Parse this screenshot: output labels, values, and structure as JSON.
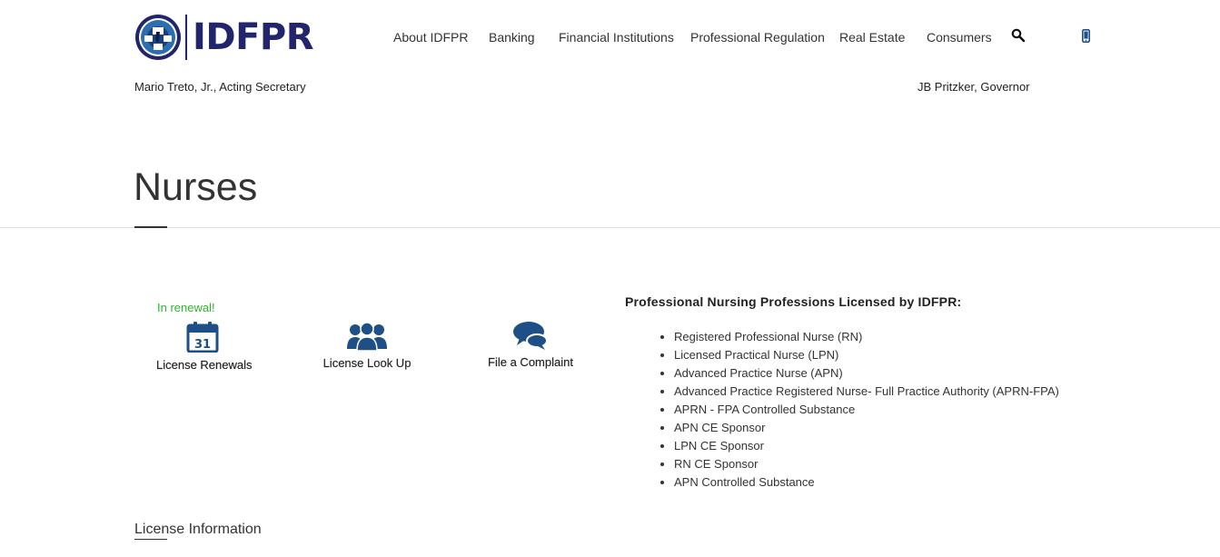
{
  "header": {
    "logo_text": "IDFPR",
    "secretary": "Mario Treto, Jr., Acting Secretary",
    "governor": "JB Pritzker, Governor",
    "nav": [
      {
        "label": "About IDFPR"
      },
      {
        "label": "Banking"
      },
      {
        "label": "Financial Institutions"
      },
      {
        "label": "Professional Regulation"
      },
      {
        "label": "Real Estate"
      },
      {
        "label": "Consumers"
      }
    ],
    "icons": {
      "search": "search-icon",
      "mobile": "mobile-phone-icon"
    }
  },
  "page": {
    "title": "Nurses"
  },
  "quick_links": {
    "renewal_note": "In renewal!",
    "calendar_day": "31",
    "items": [
      {
        "label": "License Renewals",
        "icon": "calendar-icon"
      },
      {
        "label": "License Look Up",
        "icon": "people-icon"
      },
      {
        "label": "File a Complaint",
        "icon": "speech-bubbles-icon"
      }
    ]
  },
  "professions": {
    "heading": "Professional Nursing Professions Licensed by IDFPR:",
    "items": [
      "Registered Professional Nurse (RN)",
      "Licensed Practical Nurse (LPN)",
      "Advanced Practice Nurse (APN)",
      "Advanced Practice Registered Nurse- Full Practice Authority (APRN-FPA)",
      "APRN - FPA Controlled Substance",
      "APN CE Sponsor",
      "LPN CE Sponsor",
      "RN CE Sponsor",
      "APN Controlled Substance"
    ]
  },
  "sections": {
    "license_information": "License Information"
  },
  "colors": {
    "brand_navy": "#22256b",
    "icon_blue": "#1e4f86",
    "renewal_green": "#2db52d"
  }
}
